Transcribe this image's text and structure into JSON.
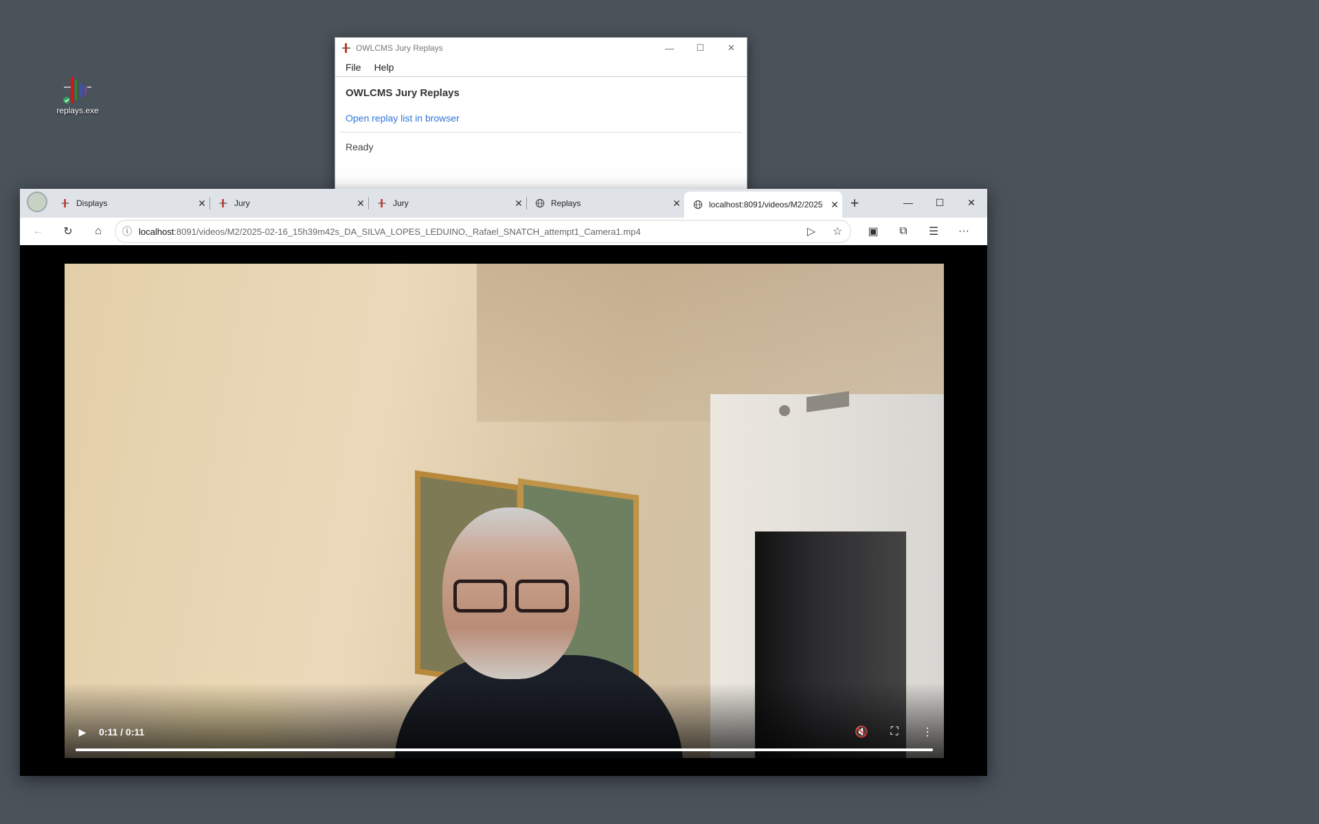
{
  "desktop": {
    "icon_label": "replays.exe"
  },
  "app_window": {
    "title": "OWLCMS Jury Replays",
    "menu": [
      "File",
      "Help"
    ],
    "heading": "OWLCMS Jury Replays",
    "link": "Open replay list in browser",
    "status": "Ready",
    "controls": {
      "minimize": "—",
      "maximize": "☐",
      "close": "✕"
    }
  },
  "browser": {
    "tabs": [
      {
        "label": "Displays",
        "icon": "owlcms-icon"
      },
      {
        "label": "Jury",
        "icon": "owlcms-icon"
      },
      {
        "label": "Jury",
        "icon": "owlcms-icon"
      },
      {
        "label": "Replays",
        "icon": "globe-icon"
      },
      {
        "label": "localhost:8091/videos/M2/2025",
        "icon": "globe-icon",
        "active": true
      }
    ],
    "new_tab": "+",
    "window_controls": {
      "minimize": "—",
      "maximize": "☐",
      "close": "✕"
    },
    "address": {
      "host": "localhost",
      "rest": ":8091/videos/M2/2025-02-16_15h39m42s_DA_SILVA_LOPES_LEDUINO,_Rafael_SNATCH_attempt1_Camera1.mp4"
    },
    "toolbar_glyphs": {
      "back": "←",
      "reload": "↻",
      "home": "⌂",
      "info": "ⓘ",
      "read_aloud": "▷",
      "favorite": "☆",
      "split": "▣",
      "extensions": "⧉",
      "favorites": "☰",
      "more": "···"
    }
  },
  "video_player": {
    "time": "0:11 / 0:11",
    "progress": 1.0,
    "play_glyph": "▶",
    "mute_glyph": "🔇",
    "fullscreen_glyph": "⛶",
    "more_glyph": "⋮"
  },
  "colors": {
    "desktop": "#4a525a",
    "link": "#2e75d8",
    "tabstrip": "#dfe3e8"
  }
}
